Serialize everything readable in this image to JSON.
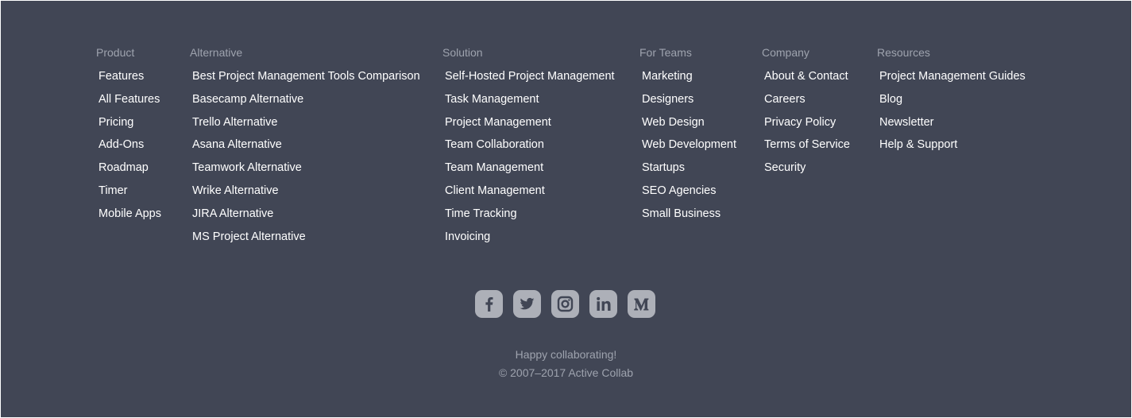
{
  "footer": {
    "columns": [
      {
        "heading": "Product",
        "links": [
          "Features",
          "All Features",
          "Pricing",
          "Add-Ons",
          "Roadmap",
          "Timer",
          "Mobile Apps"
        ]
      },
      {
        "heading": "Alternative",
        "links": [
          "Best Project Management Tools Comparison",
          "Basecamp Alternative",
          "Trello Alternative",
          "Asana Alternative",
          "Teamwork Alternative",
          "Wrike Alternative",
          "JIRA Alternative",
          "MS Project Alternative"
        ]
      },
      {
        "heading": "Solution",
        "links": [
          "Self-Hosted Project Management",
          "Task Management",
          "Project Management",
          "Team Collaboration",
          "Team Management",
          "Client Management",
          "Time Tracking",
          "Invoicing"
        ]
      },
      {
        "heading": "For Teams",
        "links": [
          "Marketing",
          "Designers",
          "Web Design",
          "Web Development",
          "Startups",
          "SEO Agencies",
          "Small Business"
        ]
      },
      {
        "heading": "Company",
        "links": [
          "About & Contact",
          "Careers",
          "Privacy Policy",
          "Terms of Service",
          "Security"
        ]
      },
      {
        "heading": "Resources",
        "links": [
          "Project Management Guides",
          "Blog",
          "Newsletter",
          "Help & Support"
        ]
      }
    ],
    "social": [
      {
        "icon": "facebook-icon"
      },
      {
        "icon": "twitter-icon"
      },
      {
        "icon": "instagram-icon"
      },
      {
        "icon": "linkedin-icon"
      },
      {
        "icon": "medium-icon"
      }
    ],
    "tagline": "Happy collaborating!",
    "copyright": "© 2007–2017 Active Collab",
    "colors": {
      "background": "#414655",
      "heading": "#9ea3ae",
      "link": "#ffffff",
      "icon_bg": "#adb0b8",
      "icon_glyph": "#414655"
    }
  }
}
